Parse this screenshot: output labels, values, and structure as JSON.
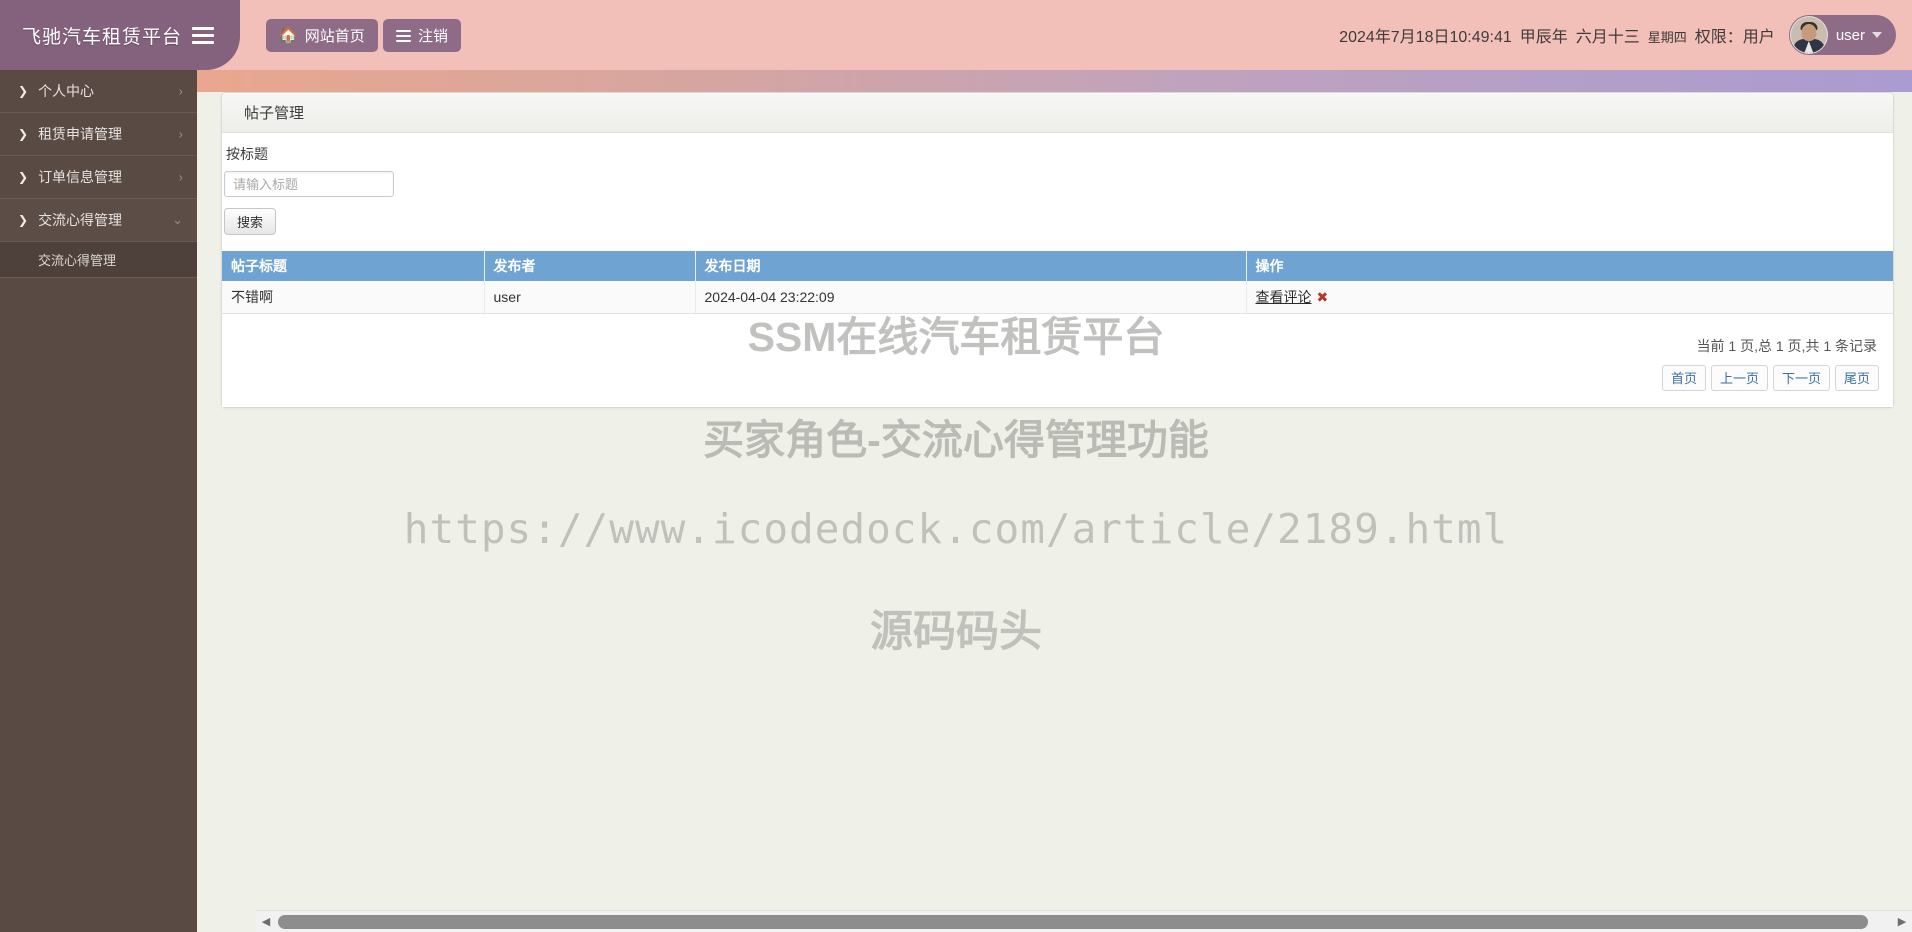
{
  "header": {
    "brand_title": "飞驰汽车租赁平台",
    "toggle_icon": "hamburger-icon",
    "nav_home_label": "网站首页",
    "nav_home_icon": "home-icon",
    "nav_logout_label": "注销",
    "nav_logout_icon": "list-icon",
    "datetime": "2024年7月18日10:49:41",
    "lunar_year": "甲辰年",
    "lunar_date": "六月十三",
    "weekday": "星期四",
    "role_label": "权限：用户",
    "user_name": "user",
    "caret_icon": "chevron-down-icon",
    "bg_color": "#f2c0b9",
    "brand_color": "#84627d",
    "button_color": "#8e6c87"
  },
  "sidebar": {
    "bg_color": "#594a44",
    "items": [
      {
        "label": "个人中心",
        "expanded": false,
        "chevron": "chevron-right-icon"
      },
      {
        "label": "租赁申请管理",
        "expanded": false,
        "chevron": "chevron-right-icon"
      },
      {
        "label": "订单信息管理",
        "expanded": false,
        "chevron": "chevron-right-icon"
      },
      {
        "label": "交流心得管理",
        "expanded": true,
        "chevron": "chevron-down-icon"
      }
    ],
    "submenu": [
      {
        "label": "交流心得管理",
        "active": true
      }
    ]
  },
  "panel": {
    "title": "帖子管理",
    "search_label": "按标题",
    "search_placeholder": "请输入标题",
    "search_value": "",
    "search_button": "搜索"
  },
  "table": {
    "header_color": "#6fa3d2",
    "columns": [
      "帖子标题",
      "发布者",
      "发布日期",
      "操作"
    ],
    "rows": [
      {
        "title": "不错啊",
        "author": "user",
        "date": "2024-04-04 23:22:09",
        "action_label": "查看评论",
        "delete_icon": "delete-x-icon"
      }
    ]
  },
  "pager": {
    "info": "当前 1 页,总 1 页,共 1 条记录",
    "buttons": [
      "首页",
      "上一页",
      "下一页",
      "尾页"
    ]
  },
  "watermark": {
    "line1": "SSM在线汽车租赁平台",
    "line2": "买家角色-交流心得管理功能",
    "line3": "https://www.icodedock.com/article/2189.html",
    "line4": "源码码头"
  },
  "scrollbar": {
    "left_arrow_icon": "triangle-left-icon",
    "right_arrow_icon": "triangle-right-icon"
  }
}
